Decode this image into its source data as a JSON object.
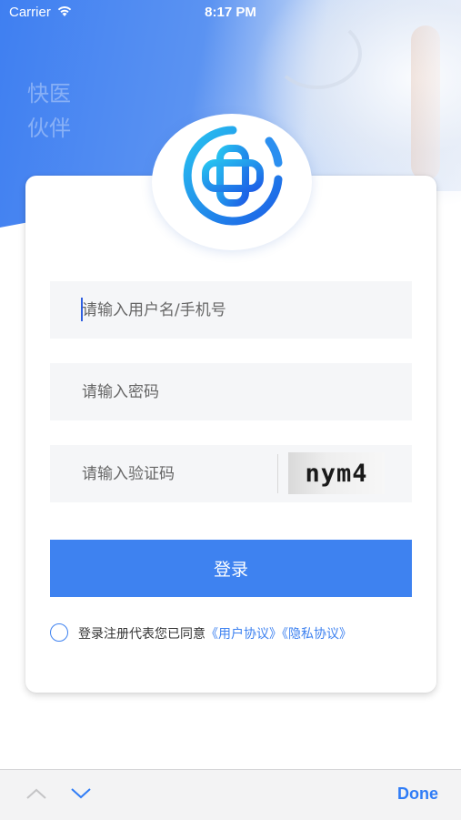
{
  "status_bar": {
    "carrier": "Carrier",
    "time": "8:17 PM"
  },
  "header": {
    "slogan_line1": "快医",
    "slogan_line2": "伙伴"
  },
  "form": {
    "username_placeholder": "请输入用户名/手机号",
    "password_placeholder": "请输入密码",
    "captcha_placeholder": "请输入验证码",
    "captcha_image_text": "nym4",
    "login_label": "登录",
    "agreement_text": "登录注册代表您已同意",
    "user_agreement_link": "《用户协议》",
    "privacy_link": "《隐私协议》"
  },
  "keyboard_toolbar": {
    "done_label": "Done"
  },
  "colors": {
    "accent": "#3e82f0",
    "header_blue": "#3f7ff1"
  }
}
